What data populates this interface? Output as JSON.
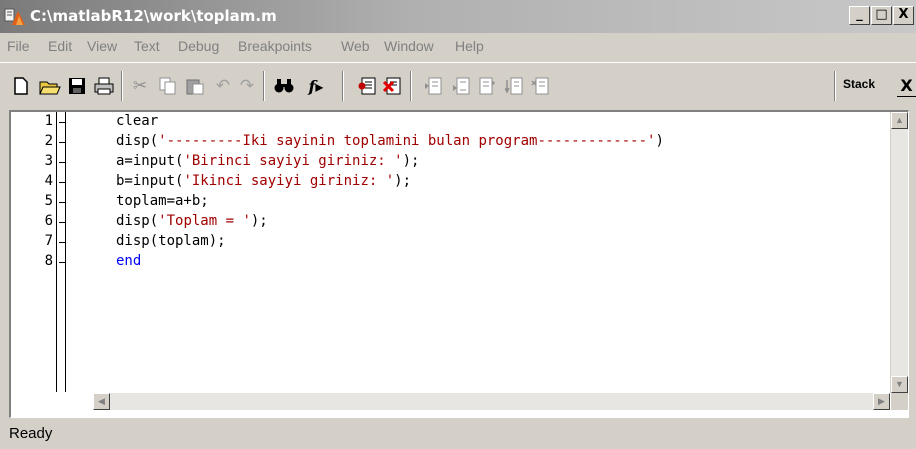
{
  "window": {
    "title": "C:\\matlabR12\\work\\toplam.m",
    "minimize_label": "_",
    "maximize_label": "□",
    "close_label": "X"
  },
  "menu": [
    "File",
    "Edit",
    "View",
    "Text",
    "Debug",
    "Breakpoints",
    "Web",
    "Window",
    "Help"
  ],
  "toolbar": {
    "icons": [
      "new-file-icon",
      "open-file-icon",
      "save-icon",
      "print-icon",
      "cut-icon",
      "copy-icon",
      "paste-icon",
      "undo-icon",
      "redo-icon",
      "find-icon",
      "function-icon",
      "set-breakpoint-icon",
      "clear-breakpoints-icon",
      "step-icon",
      "step-in-icon",
      "step-out-icon",
      "continue-icon",
      "exit-debug-icon"
    ],
    "stack_label": "Stack",
    "stack_close_label": "X"
  },
  "editor": {
    "line_numbers": [
      "1",
      "2",
      "3",
      "4",
      "5",
      "6",
      "7",
      "8"
    ],
    "lines": [
      {
        "pre": "clear",
        "str": "",
        "post": "",
        "kw": ""
      },
      {
        "pre": "disp(",
        "str": "'---------Iki sayinin toplamini bulan program-------------'",
        "post": ")",
        "kw": ""
      },
      {
        "pre": "a=input(",
        "str": "'Birinci sayiyi giriniz: '",
        "post": ");",
        "kw": ""
      },
      {
        "pre": "b=input(",
        "str": "'Ikinci sayiyi giriniz: '",
        "post": ");",
        "kw": ""
      },
      {
        "pre": "toplam=a+b;",
        "str": "",
        "post": "",
        "kw": ""
      },
      {
        "pre": "disp(",
        "str": "'Toplam = '",
        "post": ");",
        "kw": ""
      },
      {
        "pre": "disp(toplam);",
        "str": "",
        "post": "",
        "kw": ""
      },
      {
        "pre": "",
        "str": "",
        "post": "",
        "kw": "end"
      }
    ]
  },
  "status": "Ready",
  "colors": {
    "string": "#a00000",
    "keyword": "#0000ff"
  }
}
